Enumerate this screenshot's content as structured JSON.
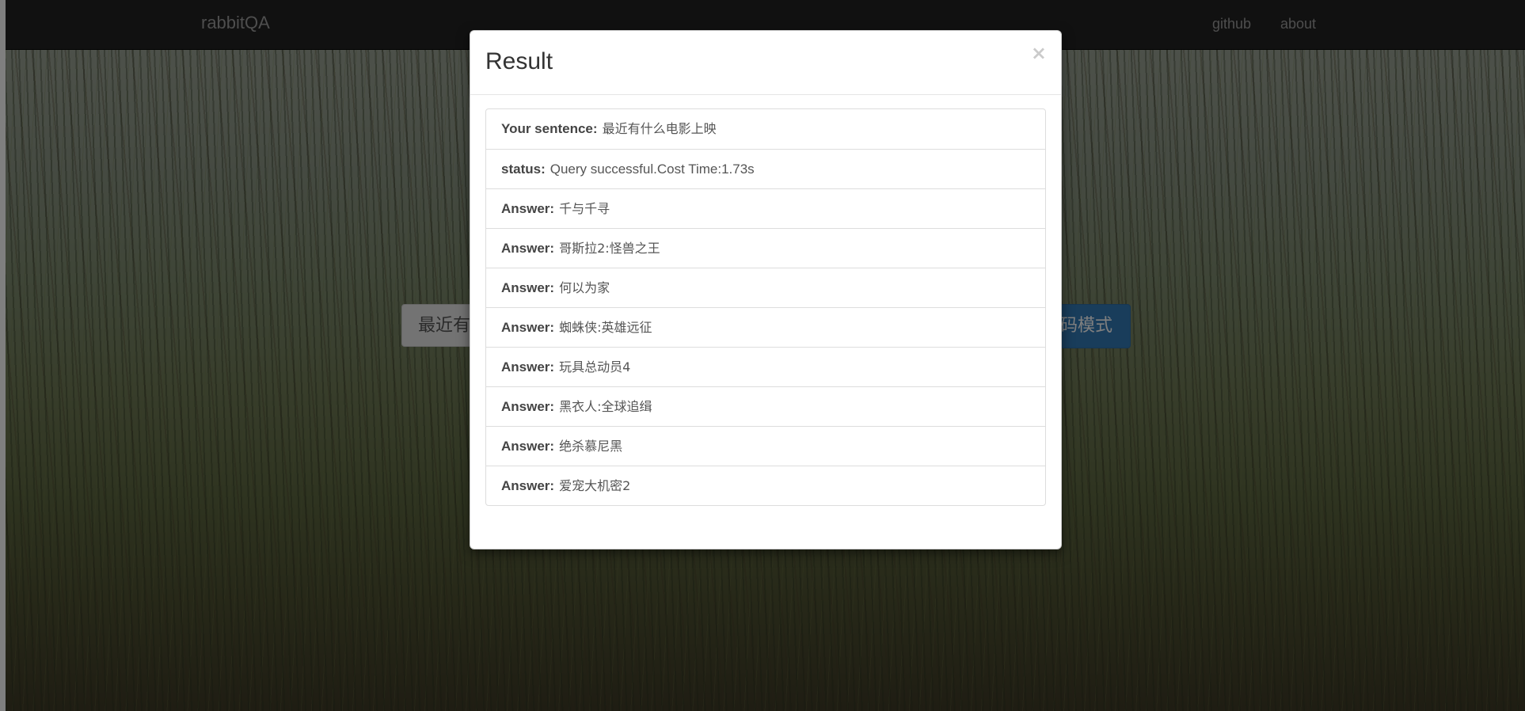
{
  "navbar": {
    "brand": "rabbitQA",
    "links": [
      {
        "label": "github"
      },
      {
        "label": "about"
      }
    ]
  },
  "main": {
    "query_text": "最近有",
    "mode_button_label": "码模式"
  },
  "modal": {
    "title": "Result",
    "close_symbol": "×",
    "items": [
      {
        "label": "Your sentence:",
        "value": "最近有什么电影上映"
      },
      {
        "label": "status:",
        "value": "Query successful.Cost Time:1.73s"
      },
      {
        "label": "Answer:",
        "value": "千与千寻"
      },
      {
        "label": "Answer:",
        "value": "哥斯拉2:怪兽之王"
      },
      {
        "label": "Answer:",
        "value": "何以为家"
      },
      {
        "label": "Answer:",
        "value": "蜘蛛侠:英雄远征"
      },
      {
        "label": "Answer:",
        "value": "玩具总动员4"
      },
      {
        "label": "Answer:",
        "value": "黑衣人:全球追缉"
      },
      {
        "label": "Answer:",
        "value": "绝杀慕尼黑"
      },
      {
        "label": "Answer:",
        "value": "爱宠大机密2"
      }
    ]
  },
  "colors": {
    "navbar_bg": "#222222",
    "nav_text": "#9d9d9d",
    "primary_button": "#337ab7",
    "modal_bg": "#ffffff",
    "backdrop": "rgba(0,0,0,0.5)"
  }
}
